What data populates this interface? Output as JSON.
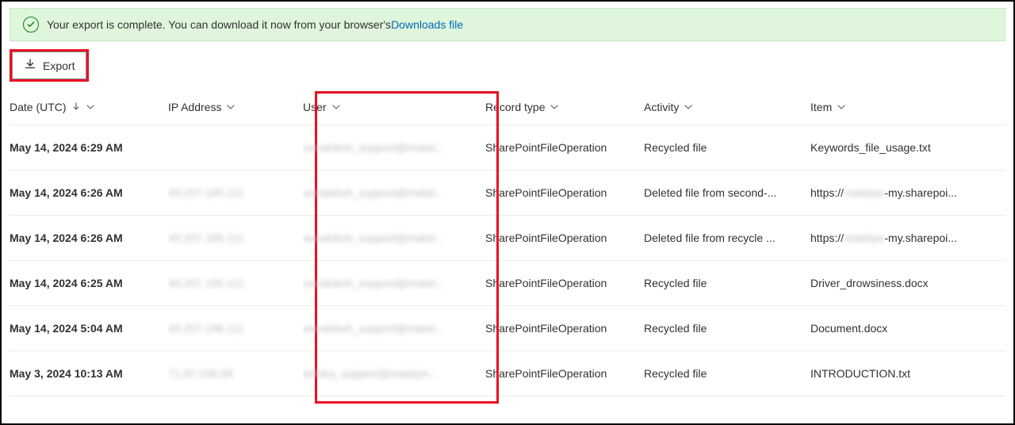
{
  "banner": {
    "text": "Your export is complete. You can download it now from your browser's",
    "link_label": "Downloads file"
  },
  "toolbar": {
    "export_label": "Export"
  },
  "columns": {
    "date": "Date (UTC)",
    "ip": "IP Address",
    "user": "User",
    "record": "Record type",
    "activity": "Activity",
    "item": "Item"
  },
  "rows": [
    {
      "date": "May 14, 2024 6:29 AM",
      "ip": "",
      "user": "weraloksh_support@matol...",
      "record": "SharePointFileOperation",
      "activity": "Recycled file",
      "item": "Keywords_file_usage.txt"
    },
    {
      "date": "May 14, 2024 6:26 AM",
      "ip": "49.207.185.111",
      "user": "weraloksh_support@matol...",
      "record": "SharePointFileOperation",
      "activity": "Deleted file from second-...",
      "item_prefix": "https://",
      "item_blur": "matolyw",
      "item_suffix": "-my.sharepoi..."
    },
    {
      "date": "May 14, 2024 6:26 AM",
      "ip": "49.207.185.111",
      "user": "weraloksh_support@matol...",
      "record": "SharePointFileOperation",
      "activity": "Deleted file from recycle ...",
      "item_prefix": "https://",
      "item_blur": "matolyw",
      "item_suffix": "-my.sharepoi..."
    },
    {
      "date": "May 14, 2024 6:25 AM",
      "ip": "49.207.185.111",
      "user": "weraloksh_support@matol...",
      "record": "SharePointFileOperation",
      "activity": "Recycled file",
      "item": "Driver_drowsiness.docx"
    },
    {
      "date": "May 14, 2024 5:04 AM",
      "ip": "49.207.186.111",
      "user": "weraloksh_support@matol...",
      "record": "SharePointFileOperation",
      "activity": "Recycled file",
      "item": "Document.docx"
    },
    {
      "date": "May 3, 2024 10:13 AM",
      "ip": "71.97.246.68",
      "user": "lethika_support@matolyn...",
      "record": "SharePointFileOperation",
      "activity": "Recycled file",
      "item": "INTRODUCTION.txt"
    }
  ]
}
